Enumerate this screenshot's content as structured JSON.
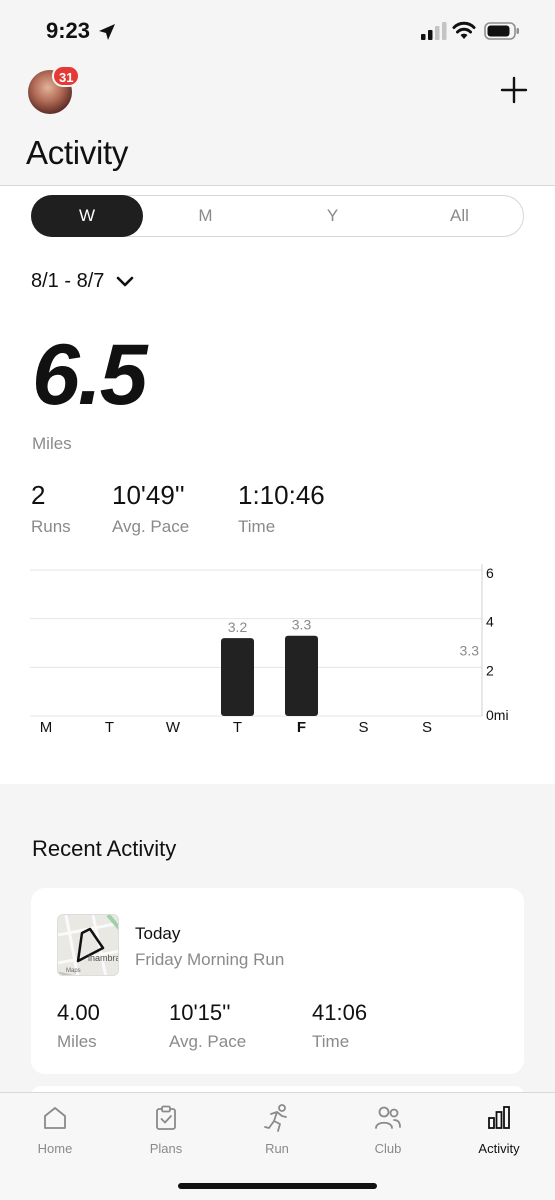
{
  "status": {
    "time": "9:23"
  },
  "header": {
    "badge_count": "31",
    "title": "Activity"
  },
  "segments": [
    "W",
    "M",
    "Y",
    "All"
  ],
  "active_segment": "W",
  "range": {
    "label": "8/1 - 8/7"
  },
  "summary": {
    "distance": "6.5",
    "unit": "Miles",
    "stats": [
      {
        "value": "2",
        "label": "Runs"
      },
      {
        "value": "10'49''",
        "label": "Avg. Pace"
      },
      {
        "value": "1:10:46",
        "label": "Time"
      }
    ]
  },
  "chart_data": {
    "type": "bar",
    "categories": [
      "M",
      "T",
      "W",
      "T",
      "F",
      "S",
      "S"
    ],
    "values": [
      0,
      0,
      0,
      3.2,
      3.3,
      0,
      0
    ],
    "data_labels": [
      "",
      "",
      "",
      "3.2",
      "3.3",
      "",
      ""
    ],
    "highlight_category_index": 4,
    "ylim": [
      0,
      6
    ],
    "yticks": [
      "0mi",
      "2",
      "4",
      "6"
    ],
    "reference_label": "3.3",
    "grid": true,
    "axis_position": "right",
    "bar_color": "#222222"
  },
  "recent": {
    "title": "Recent Activity",
    "card": {
      "date": "Today",
      "name": "Friday Morning Run",
      "map_text": "lhambra",
      "map_attribution": "Maps",
      "stats": [
        {
          "value": "4.00",
          "label": "Miles"
        },
        {
          "value": "10'15''",
          "label": "Avg. Pace"
        },
        {
          "value": "41:06",
          "label": "Time"
        }
      ]
    }
  },
  "tabs": [
    {
      "label": "Home",
      "icon": "home-icon"
    },
    {
      "label": "Plans",
      "icon": "clipboard-icon"
    },
    {
      "label": "Run",
      "icon": "runner-icon"
    },
    {
      "label": "Club",
      "icon": "people-icon"
    },
    {
      "label": "Activity",
      "icon": "bar-chart-icon"
    }
  ],
  "active_tab": "Activity",
  "colors": {
    "badge": "#e53935",
    "dark": "#1f1f1f",
    "muted": "#8a8a8a"
  }
}
